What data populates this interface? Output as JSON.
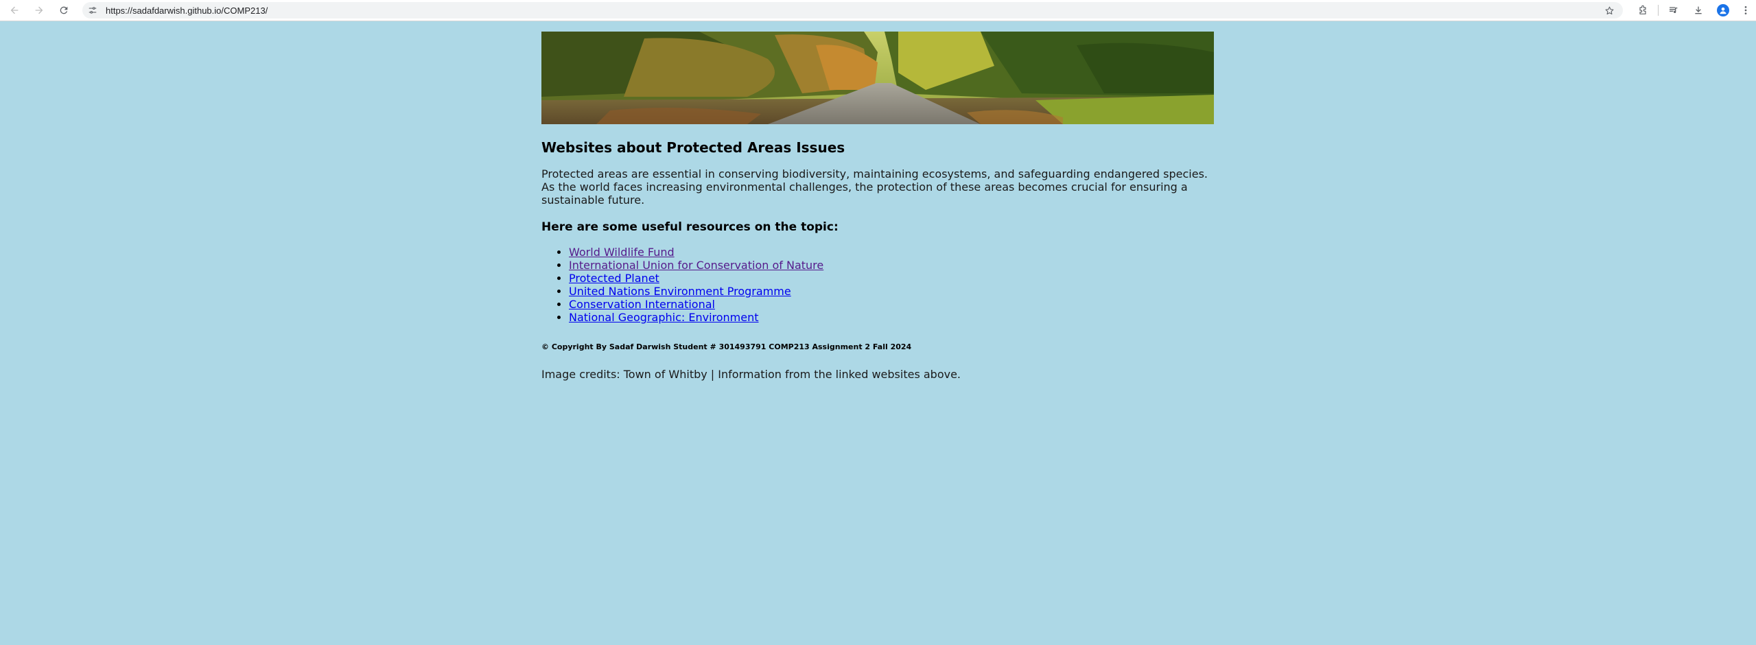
{
  "browser": {
    "url": "https://sadafdarwish.github.io/COMP213/",
    "icons": {
      "back": "arrow-left-icon",
      "forward": "arrow-right-icon",
      "reload": "reload-icon",
      "site_info": "tune-icon",
      "bookmark": "star-icon",
      "extensions": "puzzle-icon",
      "media": "playlist-icon",
      "downloads": "download-icon",
      "profile": "person-icon",
      "menu": "kebab-menu-icon"
    }
  },
  "page": {
    "heading": "Websites about Protected Areas Issues",
    "intro": "Protected areas are essential in conserving biodiversity, maintaining ecosystems, and safeguarding endangered species. As the world faces increasing environmental challenges, the protection of these areas becomes crucial for ensuring a sustainable future.",
    "resources_heading": "Here are some useful resources on the topic:",
    "links": [
      {
        "label": "World Wildlife Fund",
        "visited": true
      },
      {
        "label": "International Union for Conservation of Nature",
        "visited": true
      },
      {
        "label": "Protected Planet",
        "visited": false
      },
      {
        "label": "United Nations Environment Programme",
        "visited": false
      },
      {
        "label": "Conservation International",
        "visited": false
      },
      {
        "label": "National Geographic: Environment",
        "visited": false
      }
    ],
    "copyright": "© Copyright By Sadaf Darwish Student # 301493791 COMP213 Assignment 2 Fall 2024",
    "credits": "Image credits: Town of Whitby | Information from the linked websites above."
  },
  "colors": {
    "background": "#add8e6",
    "link": "#0000ee",
    "link_visited": "#551a8b"
  }
}
